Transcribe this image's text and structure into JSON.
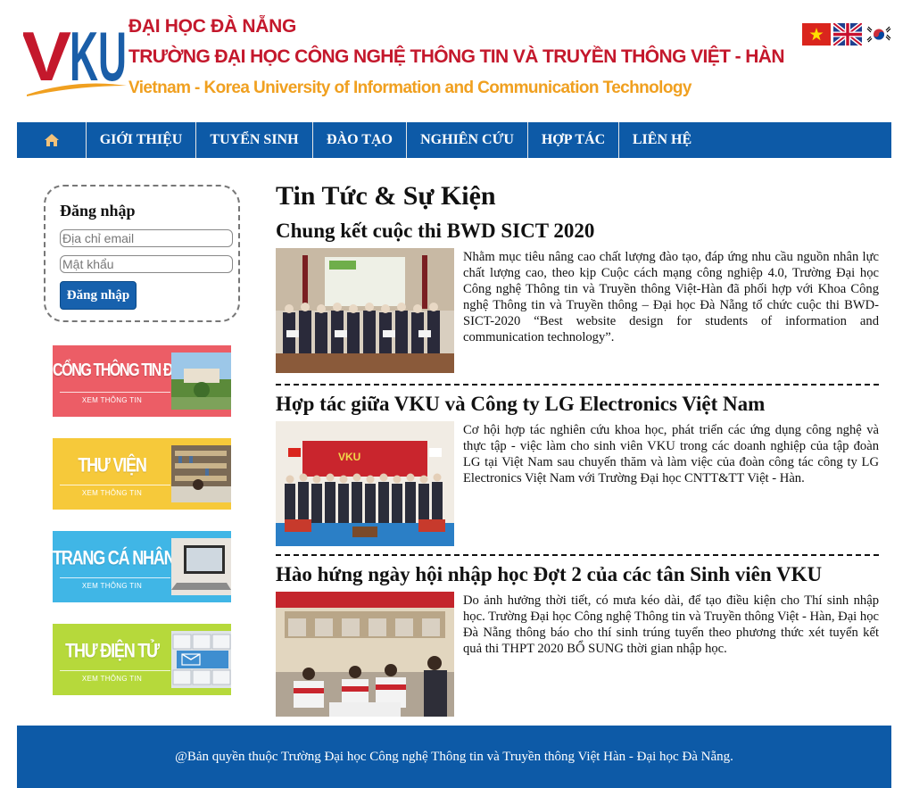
{
  "header": {
    "logo_text": "VKU",
    "line1": "ĐẠI HỌC ĐÀ NẴNG",
    "line2": "TRƯỜNG ĐẠI HỌC CÔNG NGHỆ THÔNG TIN VÀ TRUYỀN THÔNG VIỆT - HÀN",
    "line3": "Vietnam - Korea University of Information and Communication Technology",
    "flags": [
      "vietnam-flag-icon",
      "uk-flag-icon",
      "korea-flag-icon"
    ],
    "colors": {
      "logo_red": "#c4182c",
      "logo_blue": "#1a5ea8",
      "tagline_orange": "#f0a020"
    }
  },
  "nav": {
    "home_icon": "home-icon",
    "items": [
      "GIỚI THIỆU",
      "TUYỂN SINH",
      "ĐÀO TẠO",
      "NGHIÊN CỨU",
      "HỢP TÁC",
      "LIÊN HỆ"
    ],
    "background": "#0d5aa7"
  },
  "login": {
    "title": "Đăng nhập",
    "email_placeholder": "Địa chỉ email",
    "password_placeholder": "Mật khẩu",
    "button": "Đăng nhập"
  },
  "banners": [
    {
      "title": "CỔNG THÔNG TIN ĐÀO TẠO",
      "subtitle": "XEM THÔNG TIN",
      "color": "#ec5d66",
      "icon": "campus-photo-icon"
    },
    {
      "title": "THƯ VIỆN",
      "subtitle": "XEM THÔNG TIN",
      "color": "#f6c93a",
      "icon": "library-photo-icon"
    },
    {
      "title": "TRANG CÁ NHÂN",
      "subtitle": "XEM THÔNG TIN",
      "color": "#40b6e6",
      "icon": "laptop-photo-icon"
    },
    {
      "title": "THƯ ĐIỆN TỬ",
      "subtitle": "XEM THÔNG TIN",
      "color": "#b6d93b",
      "icon": "email-keyboard-icon"
    }
  ],
  "main": {
    "section_title": "Tin Tức & Sự Kiện",
    "news": [
      {
        "title": "Chung kết cuộc thi BWD SICT 2020",
        "text": "Nhằm mục tiêu nâng cao chất lượng đào tạo, đáp ứng nhu cầu nguồn nhân lực chất lượng cao, theo kịp Cuộc cách mạng công nghiệp 4.0, Trường Đại học Công nghệ Thông tin và Truyền thông Việt-Hàn đã phối hợp với Khoa Công nghệ Thông tin và Truyền thông – Đại học Đà Nẵng tổ chức cuộc thi BWD-SICT-2020 “Best website design for students of information and communication technology”.",
        "image": "award-ceremony-photo"
      },
      {
        "title": "Hợp tác giữa VKU và Công ty LG Electronics Việt Nam",
        "text": "Cơ hội hợp tác nghiên cứu khoa học, phát triển các ứng dụng công nghệ và thực tập - việc làm cho sinh viên VKU trong các doanh nghiệp của tập đoàn LG tại Việt Nam sau chuyến thăm và làm việc của đoàn công tác công ty LG Electronics Việt Nam với Trường Đại học CNTT&TT Việt - Hàn.",
        "image": "group-meeting-photo"
      },
      {
        "title": "Hào hứng ngày hội nhập học Đợt 2 của các tân Sinh viên VKU",
        "text": "Do ảnh hưởng thời tiết, có mưa kéo dài, để tạo điều kiện cho Thí sinh nhập học. Trường Đại học Công nghệ Thông tin và Truyền thông Việt - Hàn, Đại học Đà Nẵng thông báo cho thí sinh trúng tuyển theo phương thức xét tuyển kết quả thi THPT 2020 BỔ SUNG thời gian nhập học.",
        "image": "enrollment-day-photo"
      }
    ]
  },
  "footer": {
    "text": "@Bản quyền thuộc Trường Đại học Công nghệ Thông tin và Truyền thông Việt Hàn - Đại học Đà Nẵng."
  }
}
